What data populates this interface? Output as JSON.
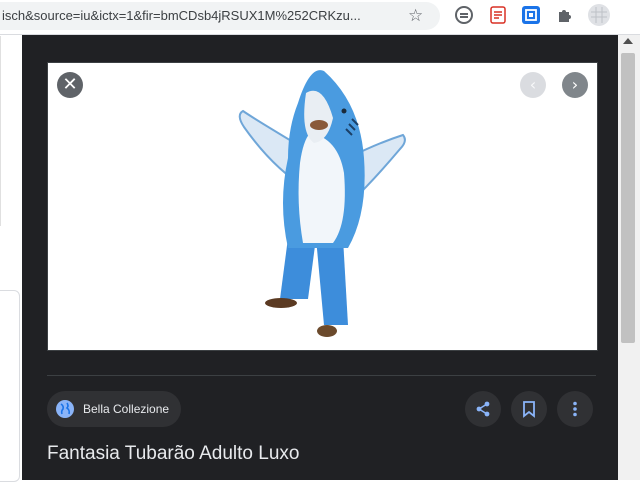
{
  "browser": {
    "url": "isch&source=iu&ictx=1&fir=bmCDsb4jRSUX1M%252CRKzu...",
    "bookmark_icon": "star-icon",
    "extensions": [
      "tab-search-icon",
      "pdf-extension-icon",
      "blue-extension-icon",
      "puzzle-icon",
      "profile-avatar"
    ]
  },
  "preview": {
    "image_alt": "Fantasia Tubarão Adulto Luxo",
    "close_glyph": "✕",
    "prev_glyph": "‹",
    "next_glyph": "›",
    "source_name": "Bella Collezione",
    "title": "Fantasia Tubarão Adulto Luxo",
    "actions": [
      "share-icon",
      "bookmark-icon",
      "more-vert-icon"
    ]
  },
  "colors": {
    "panel_bg": "#202124",
    "chip_bg": "#303134",
    "accent_blue": "#8ab4f8",
    "shark_blue": "#4a9be0"
  }
}
